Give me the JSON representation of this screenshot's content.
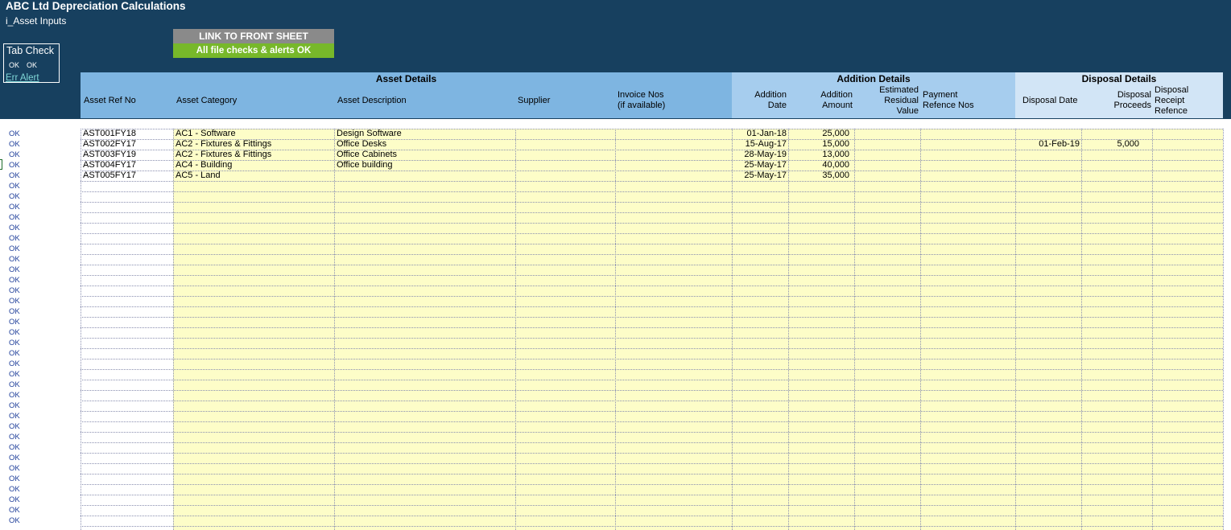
{
  "header": {
    "title": "ABC Ltd Depreciation Calculations",
    "subtitle": "i_Asset Inputs",
    "link_button": "LINK TO FRONT SHEET",
    "checks_status": "All file checks & alerts OK"
  },
  "tab_check": {
    "title": "Tab Check",
    "ok1": "OK",
    "ok2": "OK",
    "err_alert": "Err Alert"
  },
  "sections": {
    "asset": "Asset Details",
    "addition": "Addition Details",
    "disposal": "Disposal Details"
  },
  "columns": {
    "ref": "Asset Ref No",
    "category": "Asset Category",
    "description": "Asset Description",
    "supplier": "Supplier",
    "invoice_1": "Invoice Nos",
    "invoice_2": "(if available)",
    "add_date_1": "Addition",
    "add_date_2": "Date",
    "add_amt_1": "Addition",
    "add_amt_2": "Amount",
    "resid_1": "Estimated",
    "resid_2": "Residual",
    "resid_3": "Value",
    "pay_1": "Payment",
    "pay_2": "Refence Nos",
    "disp_date": "Disposal Date",
    "disp_proc_1": "Disposal",
    "disp_proc_2": "Proceeds",
    "disp_rec_1": "Disposal",
    "disp_rec_2": "Receipt",
    "disp_rec_3": "Refence"
  },
  "row_status": "OK",
  "rows": [
    {
      "ref": "AST001FY18",
      "category": "AC1 - Software",
      "description": "Design Software",
      "add_date": "01-Jan-18",
      "add_amt": "25,000",
      "disp_date": "",
      "disp_proc": ""
    },
    {
      "ref": "AST002FY17",
      "category": "AC2 - Fixtures & Fittings",
      "description": "Office Desks",
      "add_date": "15-Aug-17",
      "add_amt": "15,000",
      "disp_date": "01-Feb-19",
      "disp_proc": "5,000"
    },
    {
      "ref": "AST003FY19",
      "category": "AC2 - Fixtures & Fittings",
      "description": "Office Cabinets",
      "add_date": "28-May-19",
      "add_amt": "13,000",
      "disp_date": "",
      "disp_proc": ""
    },
    {
      "ref": "AST004FY17",
      "category": "AC4 - Building",
      "description": "Office building",
      "add_date": "25-May-17",
      "add_amt": "40,000",
      "disp_date": "",
      "disp_proc": ""
    },
    {
      "ref": "AST005FY17",
      "category": "AC5 - Land",
      "description": "",
      "add_date": "25-May-17",
      "add_amt": "35,000",
      "disp_date": "",
      "disp_proc": ""
    }
  ],
  "colors": {
    "banner": "#17405f",
    "asset_header": "#7eb5e1",
    "addition_header": "#a6cdee",
    "disposal_header": "#d2e5f6",
    "input_cell": "#fdfdc8",
    "link_button": "#8a8a8a",
    "checks_ok": "#77b82a"
  }
}
